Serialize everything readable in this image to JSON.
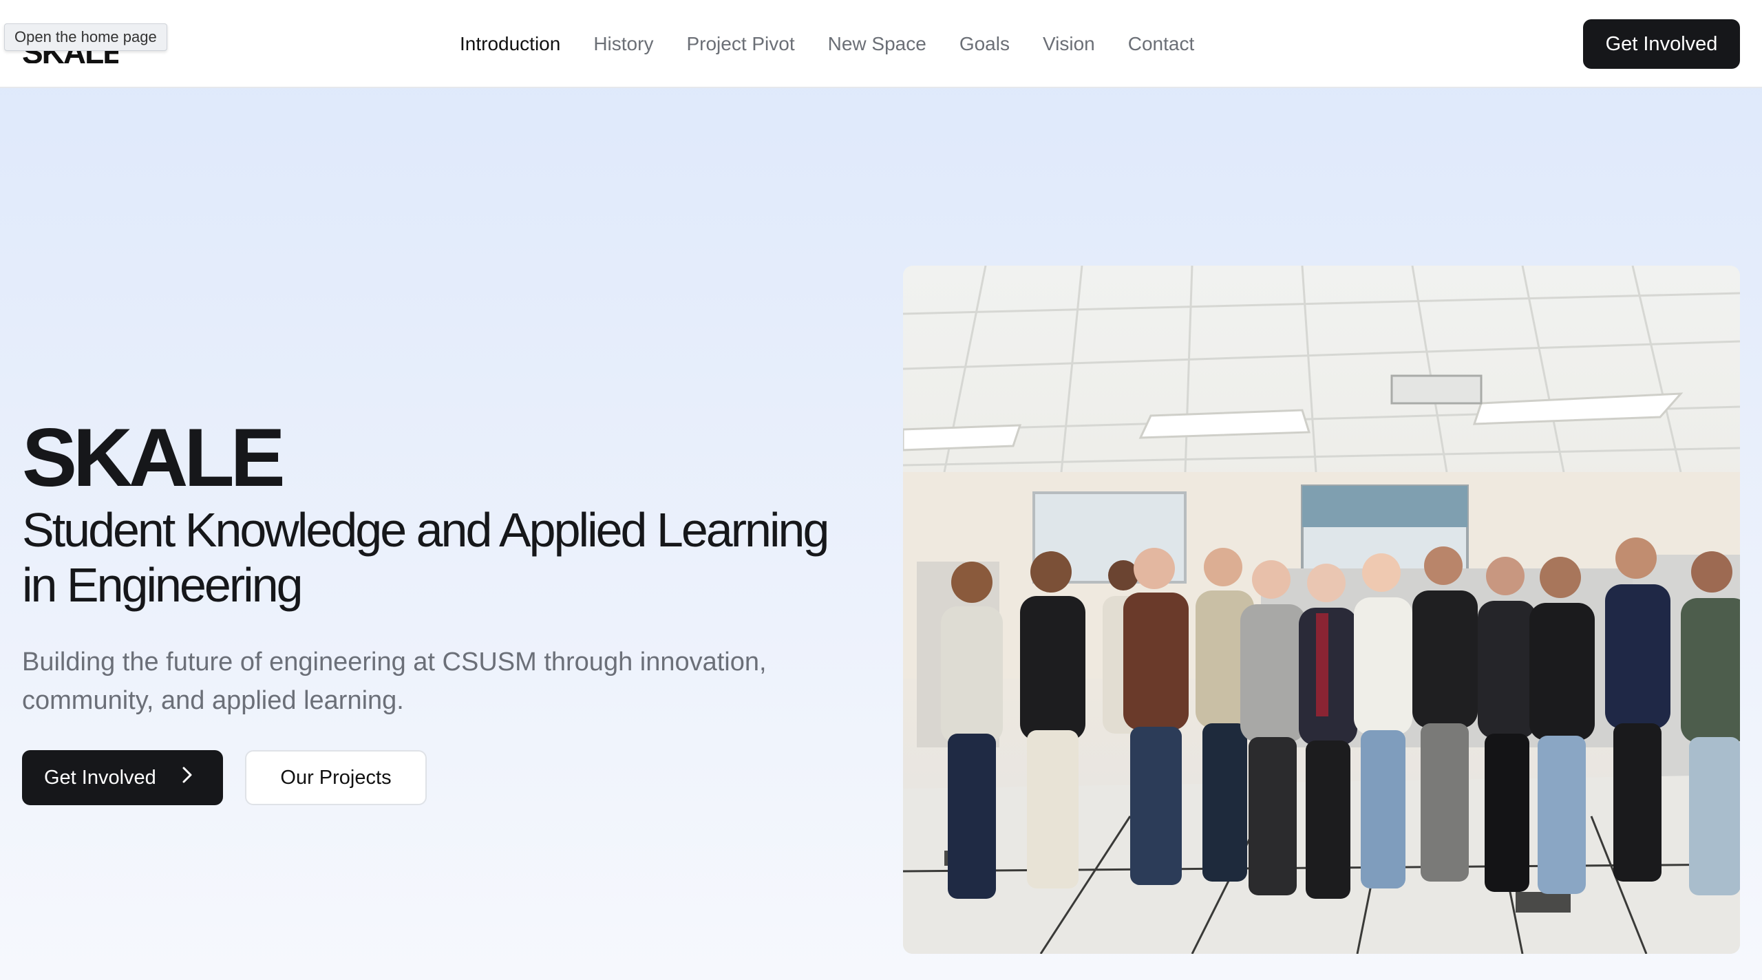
{
  "header": {
    "logo_text": "SKALE",
    "tooltip": "Open the home page",
    "nav": [
      "Introduction",
      "History",
      "Project Pivot",
      "New Space",
      "Goals",
      "Vision",
      "Contact"
    ],
    "active_nav": "Introduction",
    "cta_label": "Get Involved"
  },
  "hero": {
    "title": "SKALE",
    "subtitle": "Student Knowledge and Applied Learning in Engineering",
    "description": "Building the future of engineering at CSUSM through innovation, community, and applied learning.",
    "primary_button": "Get Involved",
    "secondary_button": "Our Projects",
    "primary_icon": "chevron-right-icon"
  },
  "image": {
    "subject": "team-group-photo"
  },
  "colors": {
    "accent": "#16171a",
    "muted_text": "#6b6f78",
    "bg_top": "#dde8fb",
    "bg_bottom": "#f6f8fd"
  }
}
